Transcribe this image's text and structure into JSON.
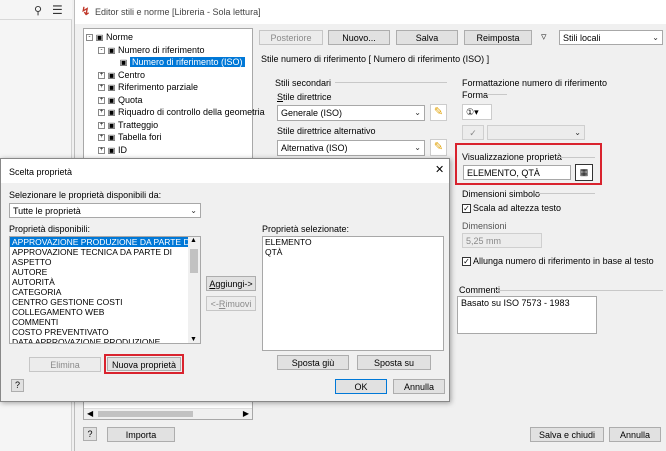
{
  "main_window": {
    "title": "Editor stili e norme [Libreria - Sola lettura]",
    "toolbar": {
      "back": "Posteriore",
      "new": "Nuovo...",
      "save": "Salva",
      "reset": "Reimposta",
      "filter": "Stili locali"
    },
    "tree": [
      {
        "label": "Norme",
        "indent": 0,
        "exp": "-"
      },
      {
        "label": "Numero di riferimento",
        "indent": 1,
        "exp": "-"
      },
      {
        "label": "Numero di riferimento (ISO)",
        "indent": 2,
        "exp": "",
        "selected": true
      },
      {
        "label": "Centro",
        "indent": 1,
        "exp": "+"
      },
      {
        "label": "Riferimento parziale",
        "indent": 1,
        "exp": "+"
      },
      {
        "label": "Quota",
        "indent": 1,
        "exp": "+"
      },
      {
        "label": "Riquadro di controllo della geometria",
        "indent": 1,
        "exp": "+"
      },
      {
        "label": "Tratteggio",
        "indent": 1,
        "exp": "+"
      },
      {
        "label": "Tabella fori",
        "indent": 1,
        "exp": "+"
      },
      {
        "label": "ID",
        "indent": 1,
        "exp": "+"
      }
    ],
    "style_header": "Stile numero di riferimento [ Numero di riferimento (ISO) ]",
    "secondary_styles": {
      "group": "Stili secondari",
      "leader_label": "Stile direttrice",
      "leader_value": "Generale (ISO)",
      "alt_label": "Stile direttrice alternativo",
      "alt_value": "Alternativa (ISO)"
    },
    "format": {
      "group": "Formattazione numero di riferimento",
      "shape_label": "Forma",
      "shape_icon": "①▾",
      "props_group": "Visualizzazione proprietà",
      "props_value": "ELEMENTO, QTÀ",
      "symbol_group": "Dimensioni simbolo",
      "scale_label": "Scala ad altezza testo",
      "size_label": "Dimensioni",
      "size_value": "5,25 mm",
      "extend_label": "Allunga numero di riferimento in base al testo"
    },
    "comments_label": "Commenti",
    "comments_value": "Basato su ISO 7573 - 1983",
    "help": "?",
    "import": "Importa",
    "save_close": "Salva e chiudi",
    "cancel": "Annulla"
  },
  "dialog": {
    "title": "Scelta proprietà",
    "close": "✕",
    "select_label": "Selezionare le proprietà disponibili da:",
    "source_value": "Tutte le proprietà",
    "available_label": "Proprietà disponibili:",
    "available": [
      "APPROVAZIONE PRODUZIONE DA PARTE DI",
      "APPROVAZIONE TECNICA DA PARTE DI",
      "ASPETTO",
      "AUTORE",
      "AUTORITÀ",
      "CATEGORIA",
      "CENTRO GESTIONE COSTI",
      "COLLEGAMENTO WEB",
      "COMMENTI",
      "COSTO PREVENTIVATO",
      "DATA APPROVAZIONE PRODUZIONE",
      "DATA APPROVAZIONE TECNICA"
    ],
    "selected_label": "Proprietà selezionate:",
    "selected": [
      "ELEMENTO",
      "QTÀ"
    ],
    "add": "Aggiungi->",
    "remove": "<-Rimuovi",
    "delete": "Elimina",
    "new_prop": "Nuova proprietà",
    "move_up": "Sposta giù",
    "move_down": "Sposta su",
    "ok": "OK",
    "cancel": "Annulla",
    "help": "?"
  },
  "colors": {
    "selection": "#0078d7",
    "highlight_border": "#d9232e"
  }
}
